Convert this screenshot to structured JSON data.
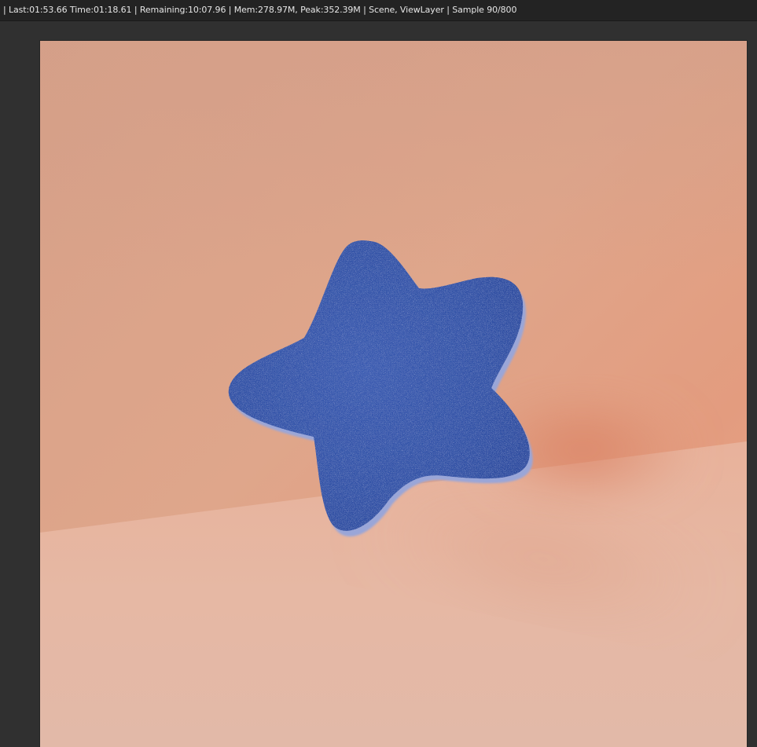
{
  "status_bar": {
    "text": "| Last:01:53.66 Time:01:18.61 | Remaining:10:07.96 | Mem:278.97M, Peak:352.39M | Scene, ViewLayer | Sample 90/800"
  },
  "render": {
    "subject": "star-shape",
    "colors": {
      "wall": "#dba58c",
      "floor": "#e5b6a2",
      "star": "#3a5aa8",
      "ui_background": "#303030",
      "status_background": "#232323",
      "status_text": "#e6e6e6"
    }
  }
}
